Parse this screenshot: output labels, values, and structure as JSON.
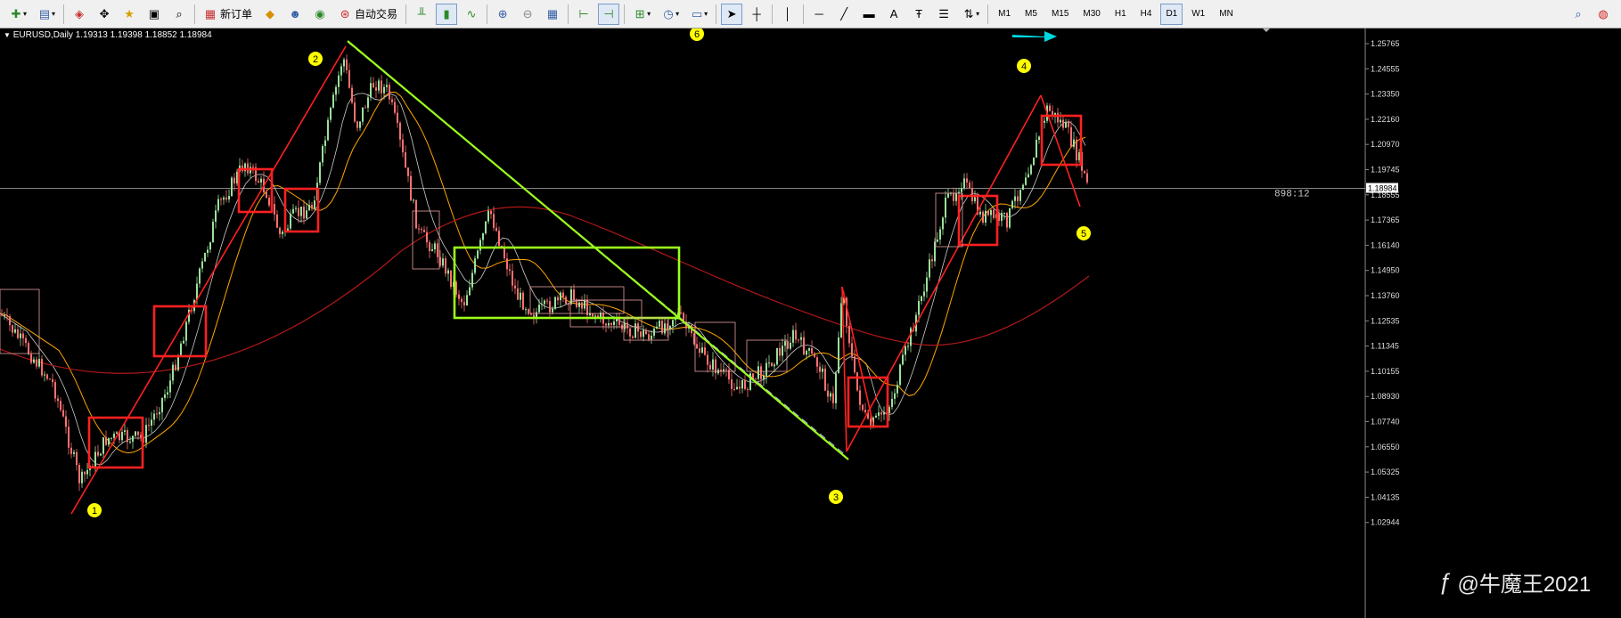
{
  "toolbar": {
    "new_order": "新订单",
    "auto_trading": "自动交易",
    "timeframes": [
      "M1",
      "M5",
      "M15",
      "M30",
      "H1",
      "H4",
      "D1",
      "W1",
      "MN"
    ],
    "active_timeframe": "D1"
  },
  "chart": {
    "symbol_label": "EURUSD,Daily",
    "ohlc": "1.19313 1.19398 1.18852 1.18984",
    "price_axis": [
      "1.25765",
      "1.24555",
      "1.23350",
      "1.22160",
      "1.20970",
      "1.19745",
      "1.18555",
      "1.17365",
      "1.16140",
      "1.14950",
      "1.13760",
      "1.12535",
      "1.11345",
      "1.10155",
      "1.08930",
      "1.07740",
      "1.06550",
      "1.05325",
      "1.04135",
      "1.02944"
    ],
    "current_price": "1.18984",
    "countdown": "898:12",
    "markers": [
      "1",
      "2",
      "3",
      "4",
      "5",
      "6"
    ]
  },
  "watermark": {
    "text": "@牛魔王2021"
  },
  "colors": {
    "bg": "#000000",
    "red": "#ff2020",
    "lime": "#9cff1a",
    "yellow": "#ffff00",
    "cyan": "#00d8e0",
    "orange": "#ffa500",
    "maroon": "#b01818",
    "lavender": "#b8b8ff"
  }
}
